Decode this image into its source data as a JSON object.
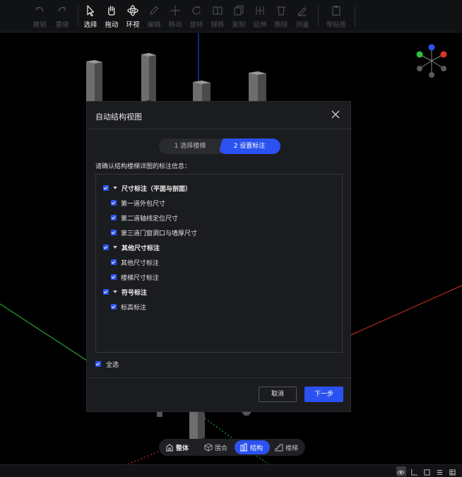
{
  "toolbar": {
    "tools": [
      {
        "id": "undo",
        "label": "撤销",
        "icon": "undo-icon",
        "enabled": false
      },
      {
        "id": "redo",
        "label": "重做",
        "icon": "redo-icon",
        "enabled": false
      },
      {
        "id": "select",
        "label": "选择",
        "icon": "cursor-icon",
        "enabled": true
      },
      {
        "id": "pan",
        "label": "拖动",
        "icon": "hand-icon",
        "enabled": true
      },
      {
        "id": "orbit",
        "label": "环视",
        "icon": "orbit-icon",
        "enabled": true
      },
      {
        "id": "edit",
        "label": "编辑",
        "icon": "pencil-icon",
        "enabled": false
      },
      {
        "id": "move",
        "label": "移动",
        "icon": "move-icon",
        "enabled": false
      },
      {
        "id": "rotate",
        "label": "旋转",
        "icon": "rotate-icon",
        "enabled": false
      },
      {
        "id": "offset",
        "label": "镜移",
        "icon": "mirror-icon",
        "enabled": false
      },
      {
        "id": "copy",
        "label": "复制",
        "icon": "copy-icon",
        "enabled": false
      },
      {
        "id": "stretch",
        "label": "延伸",
        "icon": "extend-icon",
        "enabled": false
      },
      {
        "id": "delete",
        "label": "删除",
        "icon": "trash-icon",
        "enabled": false
      },
      {
        "id": "measure",
        "label": "测量",
        "icon": "measure-icon",
        "enabled": false
      },
      {
        "id": "paste",
        "label": "带贴板",
        "icon": "clipboard-icon",
        "enabled": false
      }
    ]
  },
  "dialog": {
    "title": "自动结构视图",
    "steps": [
      "1 选择楼梯",
      "2 设置标注"
    ],
    "active_step": 2,
    "info_label": "请确认结构楼梯详图的标注信息：",
    "groups": [
      {
        "label": "尺寸标注（平面与剖面）",
        "checked": true,
        "items": [
          {
            "label": "第一道外包尺寸",
            "checked": true
          },
          {
            "label": "第二道轴线定位尺寸",
            "checked": true
          },
          {
            "label": "第三道门窗洞口与墙厚尺寸",
            "checked": true
          }
        ]
      },
      {
        "label": "其他尺寸标注",
        "checked": true,
        "items": [
          {
            "label": "其他尺寸标注",
            "checked": true
          },
          {
            "label": "楼梯尺寸标注",
            "checked": true
          }
        ]
      },
      {
        "label": "符号标注",
        "checked": true,
        "items": [
          {
            "label": "标高标注",
            "checked": true
          }
        ]
      }
    ],
    "select_all_label": "全选",
    "select_all_checked": true,
    "cancel_label": "取消",
    "next_label": "下一步"
  },
  "modes": [
    {
      "label": "整体",
      "icon": "building-icon",
      "active": false
    },
    {
      "label": "围合",
      "icon": "cube-icon",
      "active": false
    },
    {
      "label": "结构",
      "icon": "structure-icon",
      "active": true
    },
    {
      "label": "楼梯",
      "icon": "stairs-icon",
      "active": false
    }
  ],
  "colors": {
    "accent": "#2b52f0",
    "axis_x": "#e0352b",
    "axis_y": "#2fbf43",
    "axis_z": "#2b52f0"
  }
}
